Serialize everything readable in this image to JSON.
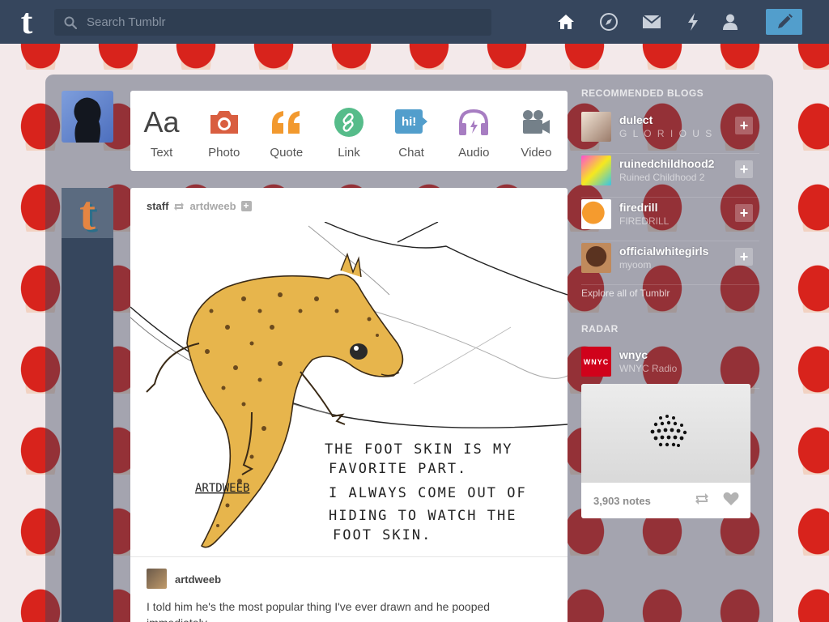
{
  "topbar": {
    "logo_letter": "t",
    "search_placeholder": "Search Tumblr",
    "nav_icons": [
      "home-icon",
      "explore-icon",
      "inbox-icon",
      "activity-icon",
      "account-icon"
    ],
    "compose_icon": "pencil-icon",
    "background": "#36465d",
    "compose_color": "#529ecc"
  },
  "post_types": [
    {
      "label": "Text",
      "glyph": "Aa",
      "icon": "text-icon",
      "color": "#444444"
    },
    {
      "label": "Photo",
      "icon": "camera-icon",
      "color": "#d95e40"
    },
    {
      "label": "Quote",
      "glyph": "“",
      "icon": "quote-icon",
      "color": "#f2992e"
    },
    {
      "label": "Link",
      "icon": "link-icon",
      "color": "#56bc8a"
    },
    {
      "label": "Chat",
      "glyph": "hi!",
      "icon": "chat-icon",
      "color": "#529ecc"
    },
    {
      "label": "Audio",
      "icon": "headphones-icon",
      "color": "#a77dc2"
    },
    {
      "label": "Video",
      "icon": "video-camera-icon",
      "color": "#748089"
    }
  ],
  "post": {
    "author": "staff",
    "reblogged_from": "artdweeb",
    "image_caption_lines": [
      "THE FOOT SKIN IS MY",
      "FAVORITE PART.",
      "I ALWAYS COME OUT OF",
      "HIDING TO WATCH THE",
      "FOOT SKIN."
    ],
    "signature": "ARTDWEEB",
    "reblog_user": "artdweeb",
    "body": "I told him he's the most popular thing I've ever drawn and he pooped immediately."
  },
  "sidebar": {
    "recommended_title": "RECOMMENDED BLOGS",
    "blogs": [
      {
        "name": "dulect",
        "subtitle": "G L O R I O U S",
        "follow": "+"
      },
      {
        "name": "ruinedchildhood2",
        "subtitle": "Ruined Childhood 2",
        "follow": "+"
      },
      {
        "name": "firedrill",
        "subtitle": "FIREDRILL",
        "follow": "+"
      },
      {
        "name": "officialwhitegirls",
        "subtitle": "myoom",
        "follow": "+"
      }
    ],
    "explore_link": "Explore all of Tumblr",
    "radar_title": "RADAR",
    "radar": {
      "name": "wnyc",
      "subtitle": "WNYC Radio",
      "logo_text": "WNYC",
      "notes": "3,903 notes"
    }
  }
}
